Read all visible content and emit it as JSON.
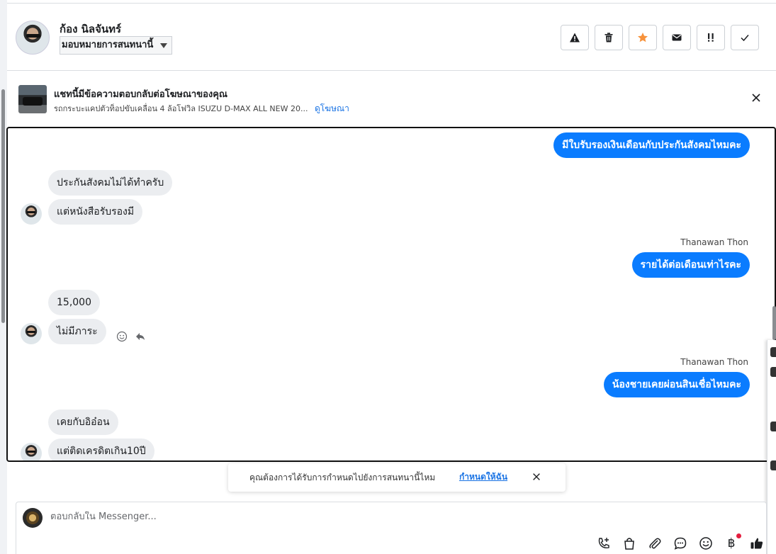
{
  "header": {
    "contact_name": "ก้อง นิลจันทร์",
    "assign_label": "มอบหมายการสนทนานี้",
    "actions": [
      {
        "icon": "warning-icon"
      },
      {
        "icon": "trash-icon"
      },
      {
        "icon": "star-icon"
      },
      {
        "icon": "mail-icon"
      },
      {
        "icon": "follow-up-icon"
      },
      {
        "icon": "check-icon"
      }
    ]
  },
  "ad": {
    "title": "แชทนี้มีข้อความตอบกลับต่อโฆษณาของคุณ",
    "subtitle": "รถกระบะแคปตัวท็อปขับเคลื่อน 4 ล้อโฟวิล ISUZU D-MAX ALL NEW 20...",
    "link": "ดูโฆษณา"
  },
  "messages": [
    {
      "dir": "out",
      "text": "มีใบรับรองเงินเดือนกับประกันสังคมไหมคะ"
    },
    {
      "dir": "in",
      "text": "ประกันสังคมไม่ได้ทำครับ"
    },
    {
      "dir": "in",
      "text": "แต่หนังสือรับรองมี"
    },
    {
      "dir": "out",
      "sender": "Thanawan Thon",
      "text": "รายได้ต่อเดือนเท่าไรคะ"
    },
    {
      "dir": "in",
      "text": "15,000"
    },
    {
      "dir": "in",
      "text": "ไม่มีภาระ"
    },
    {
      "dir": "out",
      "sender": "Thanawan Thon",
      "text": "น้องชายเคยผ่อนสินเชื่อไหมคะ"
    },
    {
      "dir": "in",
      "text": "เคยกับอิอ๋อน"
    },
    {
      "dir": "in",
      "text": "แต่ติดเครดิตเกิน10ปี"
    }
  ],
  "toast": {
    "text": "คุณต้องการได้รับการกำหนดไปยังการสนทนานี้ไหม",
    "link": "กำหนดให้ฉัน"
  },
  "composer": {
    "placeholder": "ตอบกลับใน Messenger...",
    "currency_symbol": "฿",
    "tools": [
      "phone-plus-icon",
      "shopping-bag-icon",
      "paperclip-icon",
      "chat-bubble-icon",
      "emoji-icon",
      "baht-icon",
      "thumbs-up-icon"
    ]
  },
  "colors": {
    "outgoing_bubble": "#0a7cff",
    "incoming_bubble": "#ebedf0",
    "link": "#1b74e4",
    "star": "#f7923b"
  }
}
